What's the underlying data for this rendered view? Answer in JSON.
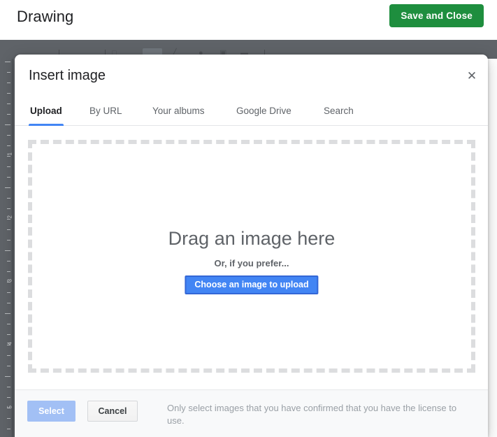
{
  "appbar": {
    "title": "Drawing",
    "save_close_label": "Save and Close",
    "save_close_color": "#1e8e3e"
  },
  "ruler": {
    "numbers": [
      "1",
      "2",
      "3",
      "4",
      "5"
    ],
    "background_color": "#5f6368"
  },
  "dialog": {
    "title": "Insert image",
    "close_icon": "close-icon",
    "close_glyph": "✕",
    "tabs": [
      {
        "label": "Upload",
        "active": true
      },
      {
        "label": "By URL",
        "active": false
      },
      {
        "label": "Your albums",
        "active": false
      },
      {
        "label": "Google Drive",
        "active": false
      },
      {
        "label": "Search",
        "active": false
      }
    ],
    "active_tab_indicator_color": "#4285f4",
    "dropzone": {
      "heading": "Drag an image here",
      "subtext": "Or, if you prefer...",
      "button_label": "Choose an image to upload",
      "button_color": "#4285f4",
      "border_style": "dashed",
      "border_color": "#dcdddf"
    },
    "footer": {
      "select_label": "Select",
      "select_disabled": true,
      "select_color": "#a2c0f5",
      "cancel_label": "Cancel",
      "license_note": "Only select images that you have confirmed that you have the license to use."
    }
  }
}
